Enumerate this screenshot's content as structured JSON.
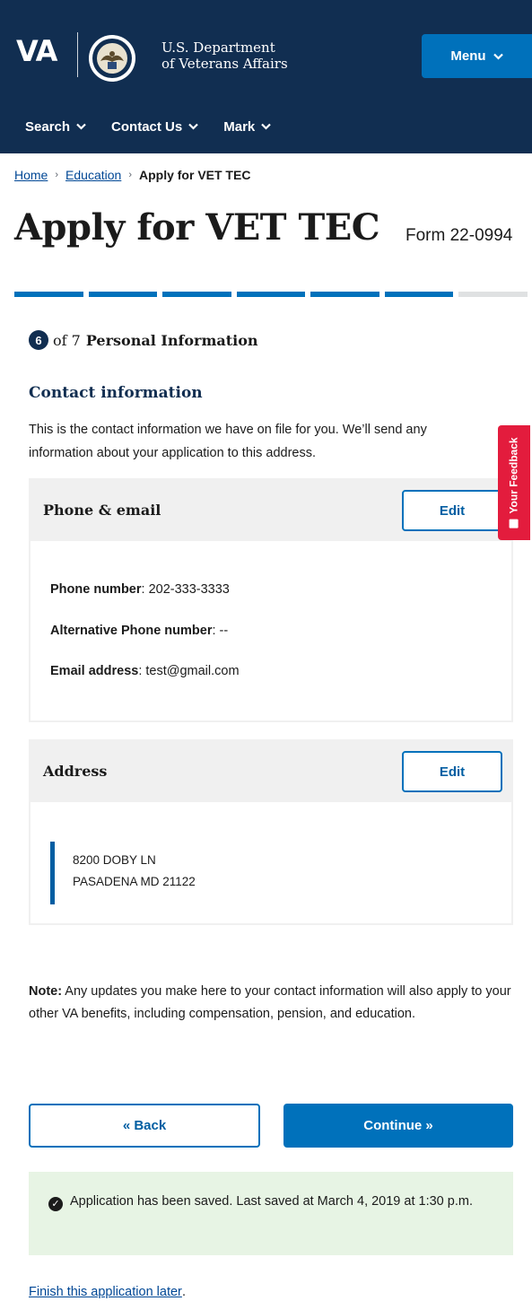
{
  "header": {
    "logo_text": "VA",
    "department_line1": "U.S. Department",
    "department_line2": "of Veterans Affairs",
    "menu_label": "Menu",
    "nav": [
      {
        "label": "Search"
      },
      {
        "label": "Contact Us"
      },
      {
        "label": "Mark"
      }
    ]
  },
  "breadcrumb": {
    "items": [
      "Home",
      "Education"
    ],
    "current": "Apply for VET TEC"
  },
  "page": {
    "title": "Apply for VET TEC",
    "form_number": "Form 22-0994"
  },
  "progress": {
    "current_step": 6,
    "total_steps": 7,
    "completed": 6
  },
  "step": {
    "number": "6",
    "of_text": "of 7",
    "name": "Personal Information"
  },
  "section": {
    "title": "Contact information",
    "intro_line1": "This is the contact information we have on file for you. We’ll send any",
    "intro_line2": "information about your application to this address."
  },
  "phone_card": {
    "title": "Phone & email",
    "edit_label": "Edit",
    "phone_label": "Phone number",
    "phone_value": ": 202-333-3333",
    "alt_phone_label": "Alternative Phone number",
    "alt_phone_value": ": --",
    "email_label": "Email address",
    "email_value": ": test@gmail.com"
  },
  "address_card": {
    "title": "Address",
    "edit_label": "Edit",
    "line1": "8200 DOBY LN",
    "line2": "PASADENA MD 21122"
  },
  "note": {
    "label": "Note:",
    "text": " Any updates you make here to your contact information will also apply to your other VA benefits, including compensation, pension, and education."
  },
  "buttons": {
    "back": "« Back",
    "continue": "Continue »"
  },
  "saved": {
    "text": "Application has been saved. Last saved at March 4, 2019 at 1:30 p.m."
  },
  "finish_link": "Finish this application later",
  "finish_period": ".",
  "feedback": {
    "label": "Your Feedback"
  },
  "colors": {
    "header_bg": "#112e51",
    "primary": "#0071bb",
    "feedback": "#e31c3d",
    "success_bg": "#e7f4e4"
  }
}
